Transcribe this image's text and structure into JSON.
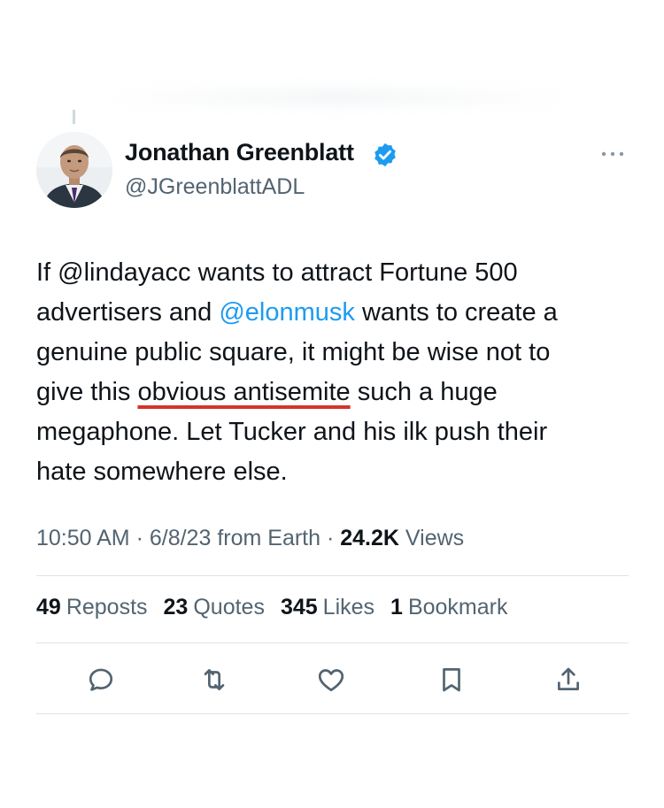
{
  "author": {
    "display_name": "Jonathan Greenblatt",
    "handle": "@JGreenblattADL",
    "verified": true,
    "avatar_icon": "profile-photo"
  },
  "tweet": {
    "lines": [
      {
        "parts": [
          {
            "text": "If @lindayacc wants to attract Fortune 500"
          }
        ]
      },
      {
        "parts": [
          {
            "text": "advertisers and "
          },
          {
            "text": "@elonmusk",
            "type": "mention"
          },
          {
            "text": " wants to create a"
          }
        ]
      },
      {
        "parts": [
          {
            "text": "genuine public square, it might be wise not to"
          }
        ]
      },
      {
        "parts": [
          {
            "text": "give this "
          },
          {
            "text": "obvious antisemite",
            "type": "highlight"
          },
          {
            "text": " such a huge"
          }
        ]
      },
      {
        "parts": [
          {
            "text": "megaphone. Let Tucker and his ilk push their"
          }
        ]
      },
      {
        "parts": [
          {
            "text": "hate somewhere else."
          }
        ]
      }
    ],
    "line1": "If @lindayacc wants to attract Fortune 500",
    "line2_pre": "advertisers and ",
    "line2_mention": "@elonmusk",
    "line2_post": " wants to create a",
    "line3": "genuine public square, it might be wise not to",
    "line4_pre": "give this ",
    "line4_highlight": "obvious antisemite",
    "line4_post": " such a huge",
    "line5": "megaphone. Let Tucker and his ilk push their",
    "line6": "hate somewhere else."
  },
  "meta": {
    "time": "10:50 AM",
    "sep1": " · ",
    "date": "6/8/23",
    "source": " from Earth",
    "sep2": " · ",
    "views_count": "24.2K",
    "views_label": " Views"
  },
  "stats": [
    {
      "count": "49",
      "label": "Reposts"
    },
    {
      "count": "23",
      "label": "Quotes"
    },
    {
      "count": "345",
      "label": "Likes"
    },
    {
      "count": "1",
      "label": "Bookmark"
    }
  ],
  "actions": [
    "reply-icon",
    "repost-icon",
    "like-icon",
    "bookmark-icon",
    "share-icon"
  ],
  "colors": {
    "text": "#0f1419",
    "secondary": "#536471",
    "link": "#1d9bf0",
    "verified": "#1d9bf0",
    "highlight_underline": "#d3352c",
    "divider": "#dfe3e6"
  }
}
